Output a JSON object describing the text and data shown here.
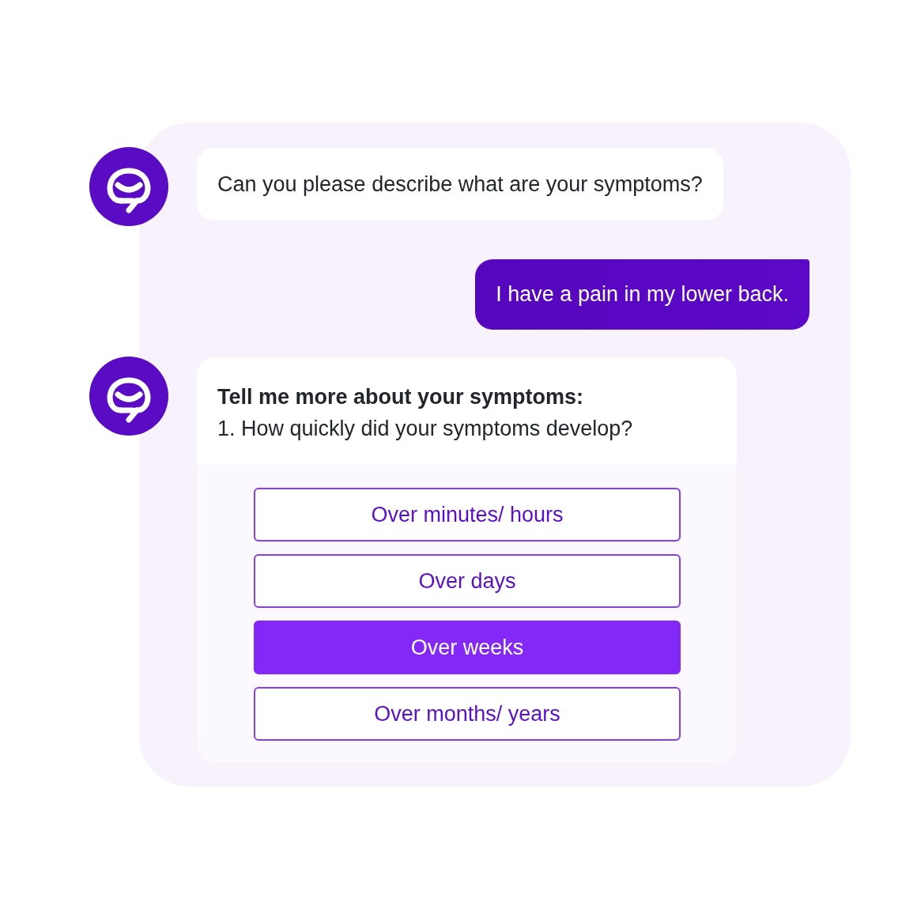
{
  "messages": [
    {
      "kind": "bot",
      "text": "Can you please describe what are your symptoms?"
    },
    {
      "kind": "user",
      "text": "I have a pain in my lower back."
    },
    {
      "kind": "bot",
      "title": "Tell me more about your symptoms:",
      "text": "1. How quickly did your symptoms develop?",
      "options": [
        {
          "label": "Over minutes/ hours",
          "selected": false
        },
        {
          "label": "Over days",
          "selected": false
        },
        {
          "label": "Over weeks",
          "selected": true
        },
        {
          "label": "Over months/ years",
          "selected": false
        }
      ]
    }
  ]
}
